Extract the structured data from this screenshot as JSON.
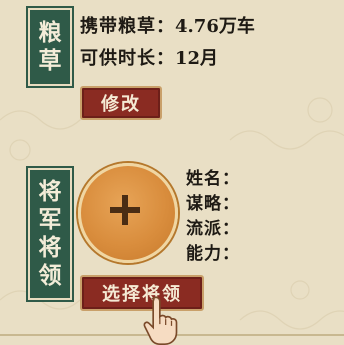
{
  "provisions": {
    "label_chars": [
      "粮",
      "草"
    ],
    "carry_label": "携带粮草：",
    "carry_value": "4.76万车",
    "supply_label": "可供时长：",
    "supply_value": "12月",
    "modify_button": "修改"
  },
  "general": {
    "label_chars": [
      "将",
      "军",
      "将",
      "领"
    ],
    "attributes": [
      "姓名：",
      "谋略：",
      "流派：",
      "能力："
    ],
    "select_button": "选择将领"
  },
  "colors": {
    "panel_green": "#2f5a48",
    "button_red": "#8a2b22",
    "background": "#e9dfc5",
    "orb_orange": "#d98d3d"
  },
  "icons": [
    "plus-icon",
    "pointing-hand-icon"
  ]
}
